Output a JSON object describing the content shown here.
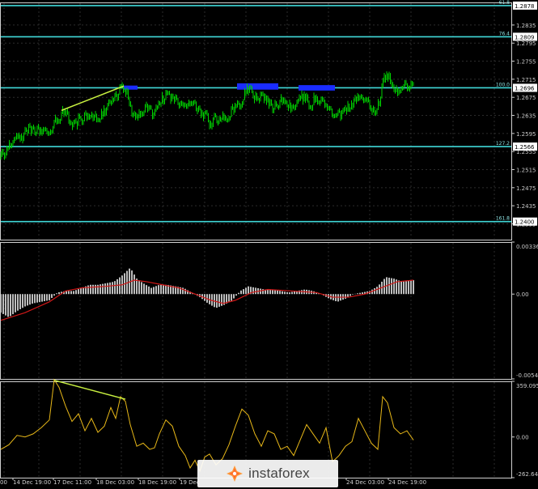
{
  "colors": {
    "background": "#000000",
    "grid": "#2c2c2c",
    "frame": "#cfcfcf",
    "candles": "#00d000",
    "level_line": "#40d8d8",
    "trend_line": "#c8f040",
    "highlight_box": "#1a2cff",
    "macd_hist": "#bdbdbd",
    "macd_signal": "#d01818",
    "oscillator": "#e8b818"
  },
  "watermark": {
    "brand": "instaforex",
    "icon": "instaforex-logo-icon"
  },
  "chart_data": [
    {
      "type": "candlestick",
      "panel": "price",
      "ylim": [
        1.236,
        1.2885
      ],
      "y_ticks": [
        "1.2835",
        "1.2795",
        "1.2755",
        "1.2715",
        "1.2675",
        "1.2635",
        "1.2595",
        "1.2555",
        "1.2515",
        "1.2475",
        "1.2435",
        "1.2395"
      ],
      "fib_levels": [
        {
          "label": "61.8",
          "value": 1.2878,
          "value_label": "1.2878"
        },
        {
          "label": "76.4",
          "value": 1.2809,
          "value_label": "1.2809"
        },
        {
          "label": "100.0",
          "value": 1.2696,
          "value_label": "1.2696"
        },
        {
          "label": "127.2",
          "value": 1.2566,
          "value_label": "1.2566"
        },
        {
          "label": "161.8",
          "value": 1.24,
          "value_label": "1.2400"
        }
      ],
      "price_path": [
        [
          0,
          1.2555
        ],
        [
          6,
          1.2545
        ],
        [
          12,
          1.2575
        ],
        [
          18,
          1.258
        ],
        [
          24,
          1.259
        ],
        [
          30,
          1.2592
        ],
        [
          36,
          1.2601
        ],
        [
          42,
          1.2597
        ],
        [
          48,
          1.2603
        ],
        [
          54,
          1.2606
        ],
        [
          60,
          1.2604
        ],
        [
          66,
          1.2618
        ],
        [
          72,
          1.263
        ],
        [
          78,
          1.2644
        ],
        [
          84,
          1.2632
        ],
        [
          90,
          1.2612
        ],
        [
          96,
          1.2624
        ],
        [
          102,
          1.2632
        ],
        [
          108,
          1.263
        ],
        [
          114,
          1.2626
        ],
        [
          120,
          1.2632
        ],
        [
          126,
          1.2636
        ],
        [
          132,
          1.2651
        ],
        [
          138,
          1.2664
        ],
        [
          144,
          1.2682
        ],
        [
          150,
          1.2693
        ],
        [
          156,
          1.268
        ],
        [
          162,
          1.2648
        ],
        [
          168,
          1.2636
        ],
        [
          174,
          1.2641
        ],
        [
          180,
          1.2648
        ],
        [
          186,
          1.2641
        ],
        [
          192,
          1.2653
        ],
        [
          198,
          1.2667
        ],
        [
          204,
          1.2677
        ],
        [
          210,
          1.2671
        ],
        [
          216,
          1.2664
        ],
        [
          222,
          1.2668
        ],
        [
          228,
          1.265
        ],
        [
          234,
          1.2663
        ],
        [
          240,
          1.2661
        ],
        [
          246,
          1.2644
        ],
        [
          252,
          1.2636
        ],
        [
          258,
          1.2617
        ],
        [
          264,
          1.2625
        ],
        [
          270,
          1.2632
        ],
        [
          276,
          1.2628
        ],
        [
          282,
          1.2634
        ],
        [
          288,
          1.2648
        ],
        [
          294,
          1.2661
        ],
        [
          300,
          1.2676
        ],
        [
          306,
          1.2691
        ],
        [
          312,
          1.2679
        ],
        [
          318,
          1.2663
        ],
        [
          324,
          1.2681
        ],
        [
          330,
          1.2664
        ],
        [
          336,
          1.2649
        ],
        [
          342,
          1.266
        ],
        [
          348,
          1.2669
        ],
        [
          354,
          1.2661
        ],
        [
          360,
          1.2657
        ],
        [
          366,
          1.2665
        ],
        [
          372,
          1.2675
        ],
        [
          378,
          1.267
        ],
        [
          384,
          1.266
        ],
        [
          390,
          1.2676
        ],
        [
          396,
          1.2668
        ],
        [
          402,
          1.2656
        ],
        [
          408,
          1.2641
        ],
        [
          414,
          1.2641
        ],
        [
          420,
          1.2631
        ],
        [
          426,
          1.265
        ],
        [
          432,
          1.2659
        ],
        [
          438,
          1.267
        ],
        [
          444,
          1.2668
        ],
        [
          450,
          1.2663
        ],
        [
          456,
          1.266
        ],
        [
          462,
          1.264
        ],
        [
          468,
          1.2662
        ],
        [
          474,
          1.2725
        ],
        [
          480,
          1.2722
        ],
        [
          486,
          1.2683
        ],
        [
          492,
          1.269
        ],
        [
          498,
          1.2705
        ],
        [
          504,
          1.2703
        ],
        [
          510,
          1.2693
        ]
      ],
      "trend_line": [
        [
          75,
          1.2646
        ],
        [
          152,
          1.27
        ]
      ],
      "highlight_boxes": [
        {
          "x0": 151,
          "x1": 169,
          "y0": 1.2701,
          "y1": 1.2692
        },
        {
          "x0": 292,
          "x1": 343,
          "y0": 1.2706,
          "y1": 1.2692
        },
        {
          "x0": 368,
          "x1": 413,
          "y0": 1.2702,
          "y1": 1.269
        }
      ]
    },
    {
      "type": "bar",
      "panel": "macd",
      "ylim": [
        -0.00548,
        0.00336
      ],
      "y_ticks": [
        "0.00336",
        "0.00",
        "-0.00548"
      ],
      "histogram_path": [
        [
          0,
          -0.0012
        ],
        [
          10,
          -0.0015
        ],
        [
          20,
          -0.0011
        ],
        [
          30,
          -0.0008
        ],
        [
          40,
          -0.0006
        ],
        [
          50,
          -0.0005
        ],
        [
          60,
          -0.0004
        ],
        [
          70,
          0.0001
        ],
        [
          80,
          0.0002
        ],
        [
          90,
          0.0002
        ],
        [
          100,
          0.0004
        ],
        [
          110,
          0.0006
        ],
        [
          120,
          0.0006
        ],
        [
          130,
          0.0007
        ],
        [
          140,
          0.0008
        ],
        [
          150,
          0.0012
        ],
        [
          160,
          0.0017
        ],
        [
          168,
          0.001
        ],
        [
          176,
          0.0007
        ],
        [
          186,
          0.0004
        ],
        [
          196,
          0.0006
        ],
        [
          206,
          0.0006
        ],
        [
          216,
          0.0005
        ],
        [
          226,
          0.0004
        ],
        [
          236,
          0.0001
        ],
        [
          246,
          -0.0002
        ],
        [
          256,
          -0.0006
        ],
        [
          266,
          -0.0009
        ],
        [
          276,
          -0.0007
        ],
        [
          286,
          -0.0004
        ],
        [
          296,
          0.0002
        ],
        [
          306,
          0.0005
        ],
        [
          316,
          0.0004
        ],
        [
          326,
          0.0003
        ],
        [
          336,
          0.0003
        ],
        [
          346,
          0.0002
        ],
        [
          356,
          0.0001
        ],
        [
          366,
          0.0002
        ],
        [
          376,
          0.0003
        ],
        [
          386,
          0.0002
        ],
        [
          396,
          0.0
        ],
        [
          406,
          -0.0003
        ],
        [
          416,
          -0.0005
        ],
        [
          426,
          -0.0003
        ],
        [
          436,
          0.0
        ],
        [
          446,
          0.0001
        ],
        [
          456,
          0.0002
        ],
        [
          466,
          0.0005
        ],
        [
          476,
          0.0011
        ],
        [
          486,
          0.001
        ],
        [
          496,
          0.0008
        ],
        [
          510,
          0.0009
        ]
      ],
      "signal_path": [
        [
          0,
          -0.0017
        ],
        [
          30,
          -0.0012
        ],
        [
          60,
          -0.0005
        ],
        [
          80,
          0.0002
        ],
        [
          100,
          0.0004
        ],
        [
          130,
          0.0005
        ],
        [
          150,
          0.0006
        ],
        [
          165,
          0.0009
        ],
        [
          180,
          0.0008
        ],
        [
          200,
          0.0006
        ],
        [
          220,
          0.0004
        ],
        [
          240,
          0.0
        ],
        [
          260,
          -0.0004
        ],
        [
          275,
          -0.0006
        ],
        [
          290,
          -0.0004
        ],
        [
          310,
          0.0001
        ],
        [
          330,
          0.0003
        ],
        [
          360,
          0.0002
        ],
        [
          390,
          0.0001
        ],
        [
          410,
          -0.0002
        ],
        [
          430,
          -0.0002
        ],
        [
          450,
          0.0
        ],
        [
          470,
          0.0004
        ],
        [
          490,
          0.0008
        ],
        [
          510,
          0.0009
        ]
      ]
    },
    {
      "type": "line",
      "panel": "oscillator",
      "ylim": [
        -262.644,
        359.0951
      ],
      "y_ticks": [
        "359.0951",
        "0.00",
        "-262.644"
      ],
      "series_path": [
        [
          0,
          -80
        ],
        [
          10,
          -50
        ],
        [
          20,
          10
        ],
        [
          30,
          0
        ],
        [
          40,
          20
        ],
        [
          50,
          60
        ],
        [
          60,
          110
        ],
        [
          66,
          370
        ],
        [
          72,
          320
        ],
        [
          80,
          200
        ],
        [
          88,
          100
        ],
        [
          96,
          150
        ],
        [
          104,
          40
        ],
        [
          112,
          120
        ],
        [
          120,
          30
        ],
        [
          128,
          70
        ],
        [
          136,
          190
        ],
        [
          142,
          120
        ],
        [
          148,
          260
        ],
        [
          154,
          230
        ],
        [
          160,
          80
        ],
        [
          168,
          -60
        ],
        [
          176,
          -40
        ],
        [
          184,
          -80
        ],
        [
          190,
          -70
        ],
        [
          196,
          20
        ],
        [
          204,
          110
        ],
        [
          212,
          70
        ],
        [
          220,
          -60
        ],
        [
          228,
          -120
        ],
        [
          234,
          -200
        ],
        [
          240,
          -150
        ],
        [
          246,
          -220
        ],
        [
          252,
          -130
        ],
        [
          258,
          -110
        ],
        [
          266,
          -180
        ],
        [
          274,
          -140
        ],
        [
          282,
          -50
        ],
        [
          290,
          70
        ],
        [
          298,
          180
        ],
        [
          306,
          140
        ],
        [
          314,
          20
        ],
        [
          322,
          -60
        ],
        [
          330,
          40
        ],
        [
          338,
          20
        ],
        [
          346,
          -80
        ],
        [
          354,
          -60
        ],
        [
          362,
          -120
        ],
        [
          370,
          -20
        ],
        [
          378,
          80
        ],
        [
          386,
          20
        ],
        [
          394,
          -40
        ],
        [
          402,
          60
        ],
        [
          410,
          -160
        ],
        [
          418,
          -120
        ],
        [
          426,
          -60
        ],
        [
          434,
          -30
        ],
        [
          442,
          120
        ],
        [
          450,
          40
        ],
        [
          458,
          -40
        ],
        [
          466,
          -80
        ],
        [
          472,
          260
        ],
        [
          478,
          220
        ],
        [
          486,
          60
        ],
        [
          494,
          20
        ],
        [
          502,
          40
        ],
        [
          510,
          -20
        ]
      ],
      "trend_line": [
        [
          66,
          366
        ],
        [
          154,
          244
        ]
      ]
    }
  ],
  "x_axis": {
    "labels": [
      "14 Dec 19:00",
      "17 Dec 11:00",
      "18 Dec 03:00",
      "18 Dec 19:00",
      "19 Dec",
      "24 Dec 03:00",
      "24 Dec 19:00"
    ]
  },
  "left_edge_label": "00"
}
